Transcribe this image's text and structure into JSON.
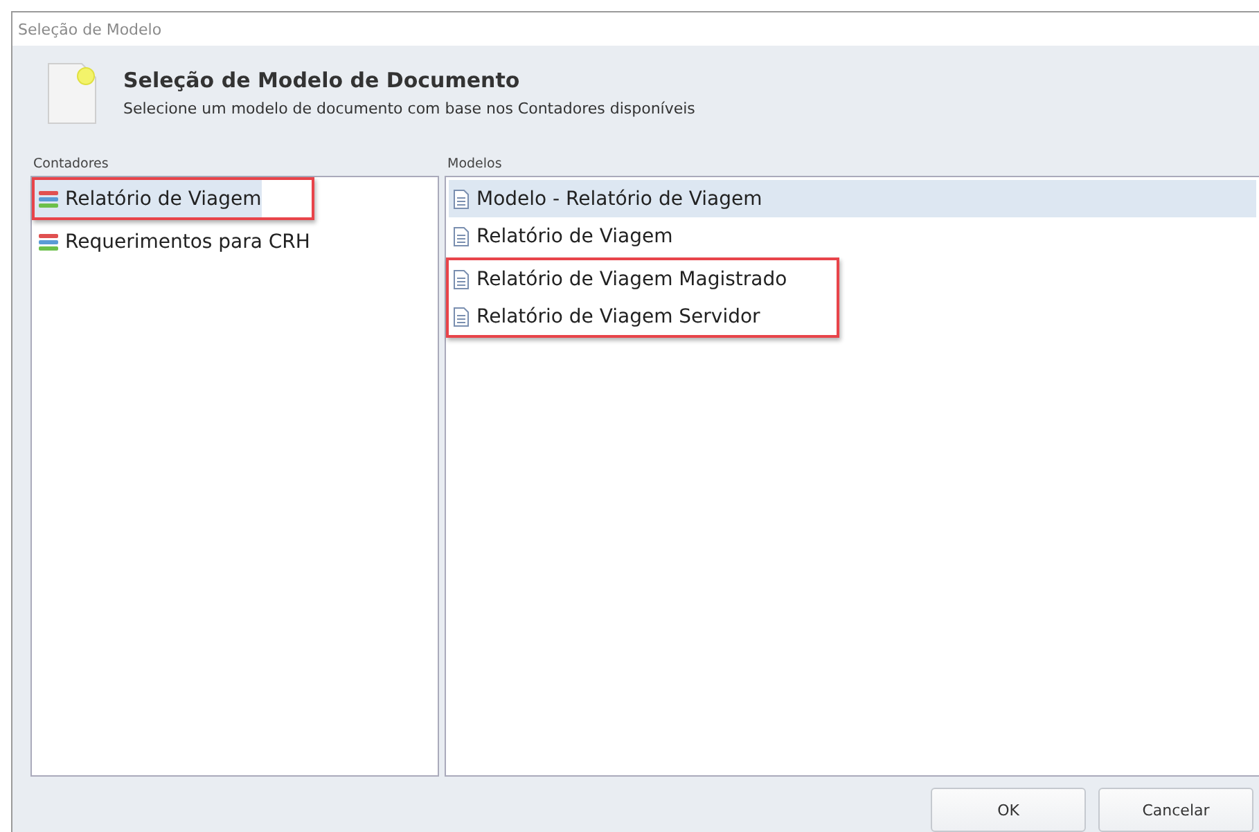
{
  "window": {
    "title": "Seleção de Modelo"
  },
  "header": {
    "title": "Seleção de Modelo de Documento",
    "subtitle": "Selecione um modelo de documento com base nos Contadores disponíveis"
  },
  "contadores": {
    "label": "Contadores",
    "items": [
      {
        "label": "Relatório de Viagem",
        "selected": true,
        "highlighted": true
      },
      {
        "label": "Requerimentos para CRH",
        "selected": false,
        "highlighted": false
      }
    ]
  },
  "modelos": {
    "label": "Modelos",
    "items": [
      {
        "label": "Modelo - Relatório de Viagem",
        "selected": true,
        "highlighted": false
      },
      {
        "label": "Relatório de Viagem",
        "selected": false,
        "highlighted": false
      },
      {
        "label": "Relatório de Viagem Magistrado",
        "selected": false,
        "highlighted": true
      },
      {
        "label": "Relatório de Viagem Servidor",
        "selected": false,
        "highlighted": true
      }
    ]
  },
  "buttons": [
    "OK",
    "Cancelar"
  ]
}
